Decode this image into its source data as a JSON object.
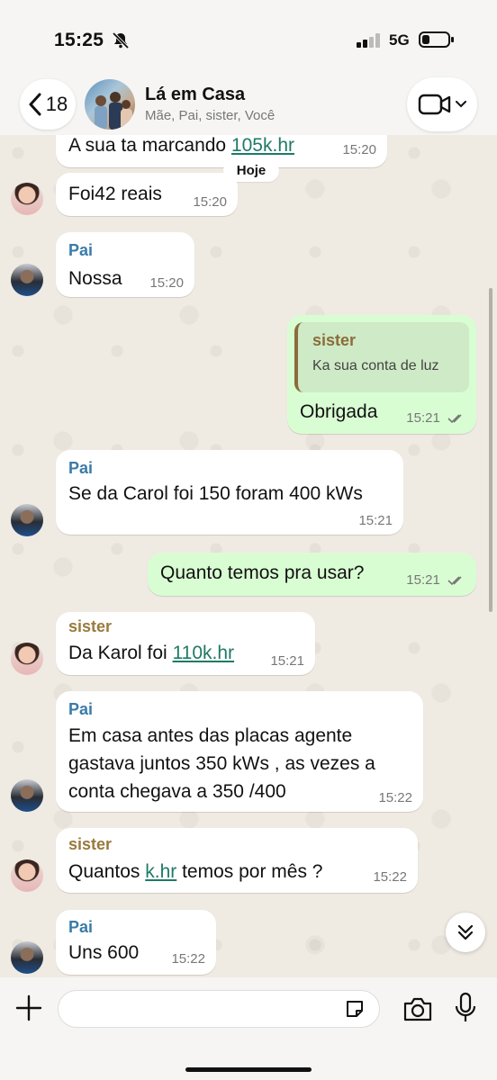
{
  "status": {
    "time": "15:25",
    "network": "5G"
  },
  "header": {
    "back_count": "18",
    "title": "Lá em Casa",
    "participants": "Mãe, Pai, sister, Você"
  },
  "chat": {
    "date_label": "Hoje",
    "messages": [
      {
        "direction": "in",
        "sender": "",
        "text_prefix": "A sua ta marcando ",
        "link": "105k.hr",
        "text_suffix": "",
        "time": "15:20"
      },
      {
        "direction": "in",
        "sender": "",
        "text": "Foi42 reais",
        "time": "15:20"
      },
      {
        "direction": "in",
        "sender": "Pai",
        "text": "Nossa",
        "time": "15:20"
      },
      {
        "direction": "out",
        "quote_sender": "sister",
        "quote_text": "Ka sua conta de luz",
        "text": "Obrigada",
        "time": "15:21"
      },
      {
        "direction": "in",
        "sender": "Pai",
        "text": "Se da Carol foi 150 foram 400 kWs",
        "time": "15:21"
      },
      {
        "direction": "out",
        "text": "Quanto temos pra usar?",
        "time": "15:21"
      },
      {
        "direction": "in",
        "sender": "sister",
        "text_prefix": "Da Karol foi ",
        "link": "110k.hr",
        "text_suffix": "",
        "time": "15:21"
      },
      {
        "direction": "in",
        "sender": "Pai",
        "lines": [
          "Em casa antes das placas agente",
          "gastava juntos 350 kWs , as vezes a",
          "conta chegava a 350 /400"
        ],
        "time": "15:22"
      },
      {
        "direction": "in",
        "sender": "sister",
        "text_prefix": "Quantos ",
        "link": "k.hr",
        "text_suffix": " temos por mês ?",
        "time": "15:22"
      },
      {
        "direction": "in",
        "sender": "Pai",
        "text": "Uns 600",
        "time": "15:22"
      }
    ]
  },
  "composer": {
    "placeholder": ""
  },
  "icons": {
    "back": "chevron-left-icon",
    "video": "video-camera-icon",
    "plus": "plus-icon",
    "sticker": "sticker-icon",
    "camera": "camera-icon",
    "mic": "microphone-icon",
    "scroll": "double-chevron-down-icon",
    "silent": "bell-slash-icon"
  },
  "colors": {
    "outgoing_bubble": "#d9fdd3",
    "incoming_bubble": "#ffffff",
    "pai_name": "#3a7ba8",
    "sister_name": "#9a7a3c",
    "link": "#1f7a66"
  }
}
